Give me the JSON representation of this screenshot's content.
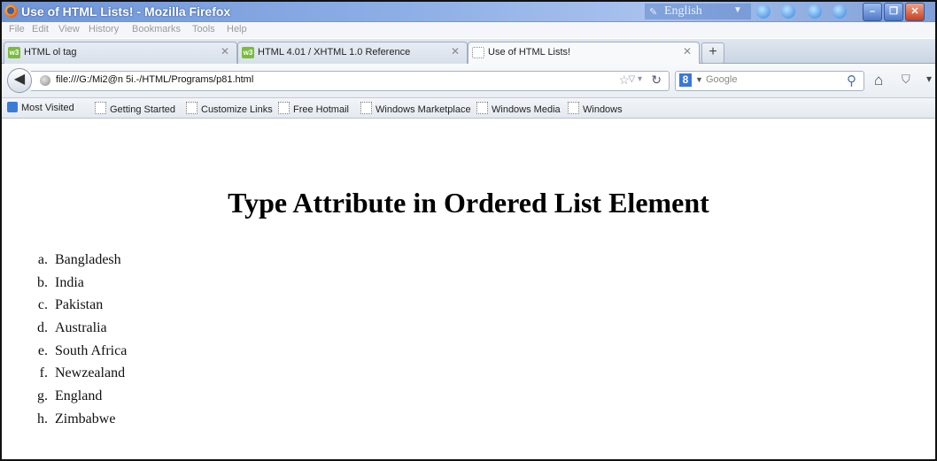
{
  "window": {
    "title": "Use of HTML Lists! - Mozilla Firefox",
    "language": "English"
  },
  "menu": [
    "File",
    "Edit",
    "View",
    "History",
    "Bookmarks",
    "Tools",
    "Help"
  ],
  "tabs": [
    {
      "label": "HTML ol tag",
      "icon": "w3-icon",
      "active": false
    },
    {
      "label": "HTML 4.01 / XHTML 1.0 Reference",
      "icon": "w3-icon",
      "active": false
    },
    {
      "label": "Use of HTML Lists!",
      "icon": "blank-page-icon",
      "active": true
    }
  ],
  "nav": {
    "url": "file:///G:/Mi2@n 5i.-/HTML/Programs/p81.html",
    "search_engine": "Google"
  },
  "bookmarks": [
    "Most Visited",
    "Getting Started",
    "Customize Links",
    "Free Hotmail",
    "Windows Marketplace",
    "Windows Media",
    "Windows"
  ],
  "page": {
    "heading": "Type Attribute in Ordered List Element",
    "list_type": "a",
    "items": [
      "Bangladesh",
      "India",
      "Pakistan",
      "Australia",
      "South Africa",
      "Newzealand",
      "England",
      "Zimbabwe"
    ]
  },
  "colors": {
    "titlebar": "#6f95d8",
    "page_background": "#ffffff",
    "text": "#000000"
  }
}
